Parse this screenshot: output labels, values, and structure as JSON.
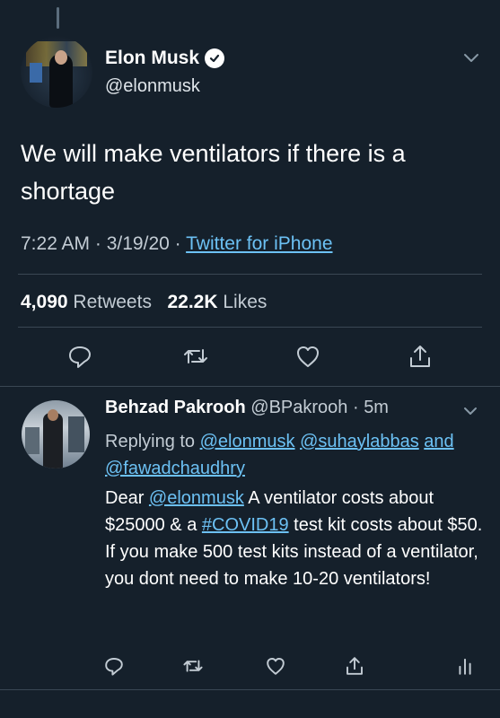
{
  "main_tweet": {
    "author_name": "Elon Musk",
    "handle": "@elonmusk",
    "text": "We will make ventilators if there is a shortage",
    "time": "7:22 AM",
    "date": "3/19/20",
    "source": "Twitter for iPhone",
    "retweets_count": "4,090",
    "retweets_label": "Retweets",
    "likes_count": "22.2K",
    "likes_label": "Likes"
  },
  "reply": {
    "author_name": "Behzad Pakrooh",
    "handle": "@BPakrooh",
    "time_ago": "5m",
    "replying_prefix": "Replying to",
    "mention_1": "@elonmusk",
    "mention_2": "@suhaylabbas",
    "and_word": "and",
    "mention_3": "@fawadchaudhry",
    "body_prefix": "Dear",
    "body_mention": "@elonmusk",
    "body_part1": "A ventilator costs about $25000 & a",
    "hashtag": "#COVID19",
    "body_part2": "test kit costs about $50.",
    "body_line2": "If you make 500 test kits instead of a ventilator, you dont need to make 10-20 ventilators!"
  },
  "icons": [
    "thread-line",
    "verified-badge-icon",
    "chevron-down-icon",
    "reply-icon",
    "retweet-icon",
    "like-icon",
    "share-icon",
    "analytics-icon"
  ],
  "colors": {
    "background": "#15202b",
    "link": "#6cc1f4",
    "secondary_text": "#c3ccd4",
    "divider": "#3a4754"
  }
}
